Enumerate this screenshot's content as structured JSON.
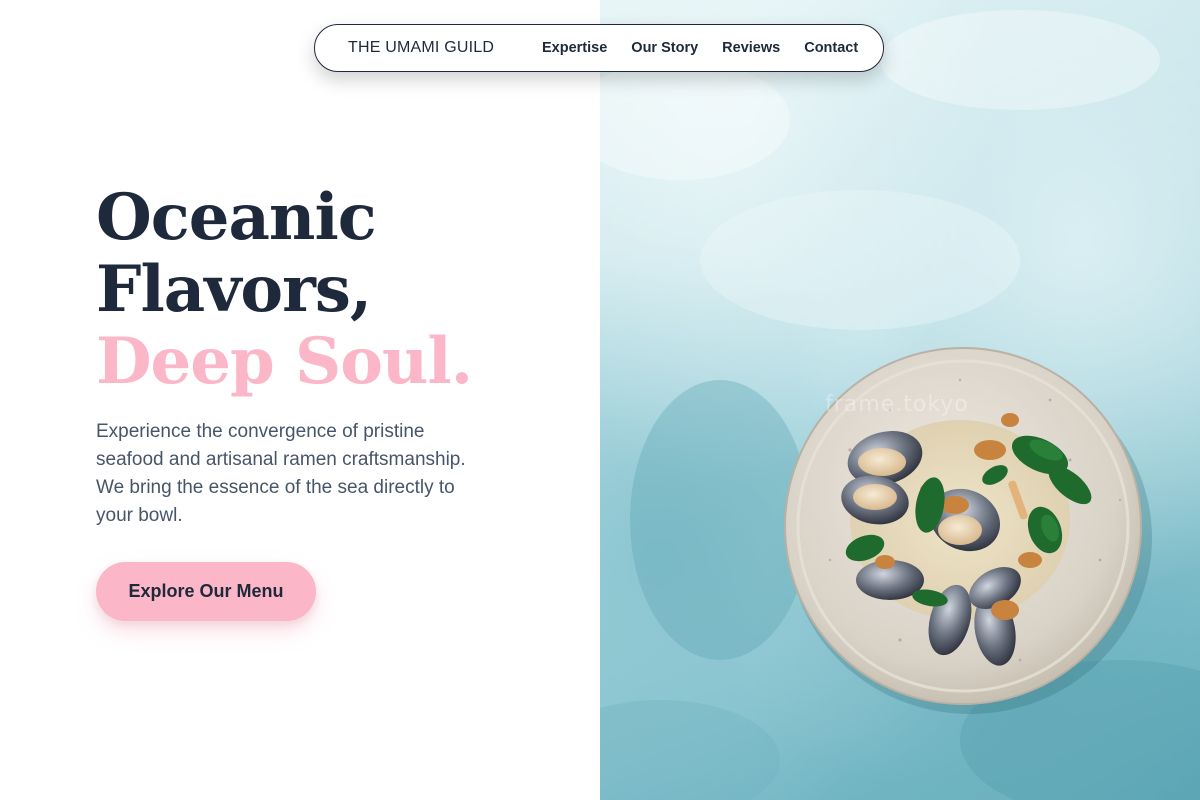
{
  "nav": {
    "brand": "THE UMAMI GUILD",
    "links": [
      "Expertise",
      "Our Story",
      "Reviews",
      "Contact"
    ]
  },
  "hero": {
    "headline_line1": "Oceanic",
    "headline_line2": "Flavors,",
    "headline_accent": "Deep Soul.",
    "intro": "Experience the convergence of pristine seafood and artisanal ramen craftsmanship. We bring the essence of the sea directly to your bowl.",
    "cta_label": "Explore Our Menu",
    "image_watermark": "frame.tokyo"
  },
  "colors": {
    "text_dark": "#1e293b",
    "accent_pink": "#fbb6c8",
    "body_text": "#475569",
    "ocean_blue": "#7dbdc9"
  },
  "icons": {
    "hero_image": "clam-dish-photo"
  }
}
